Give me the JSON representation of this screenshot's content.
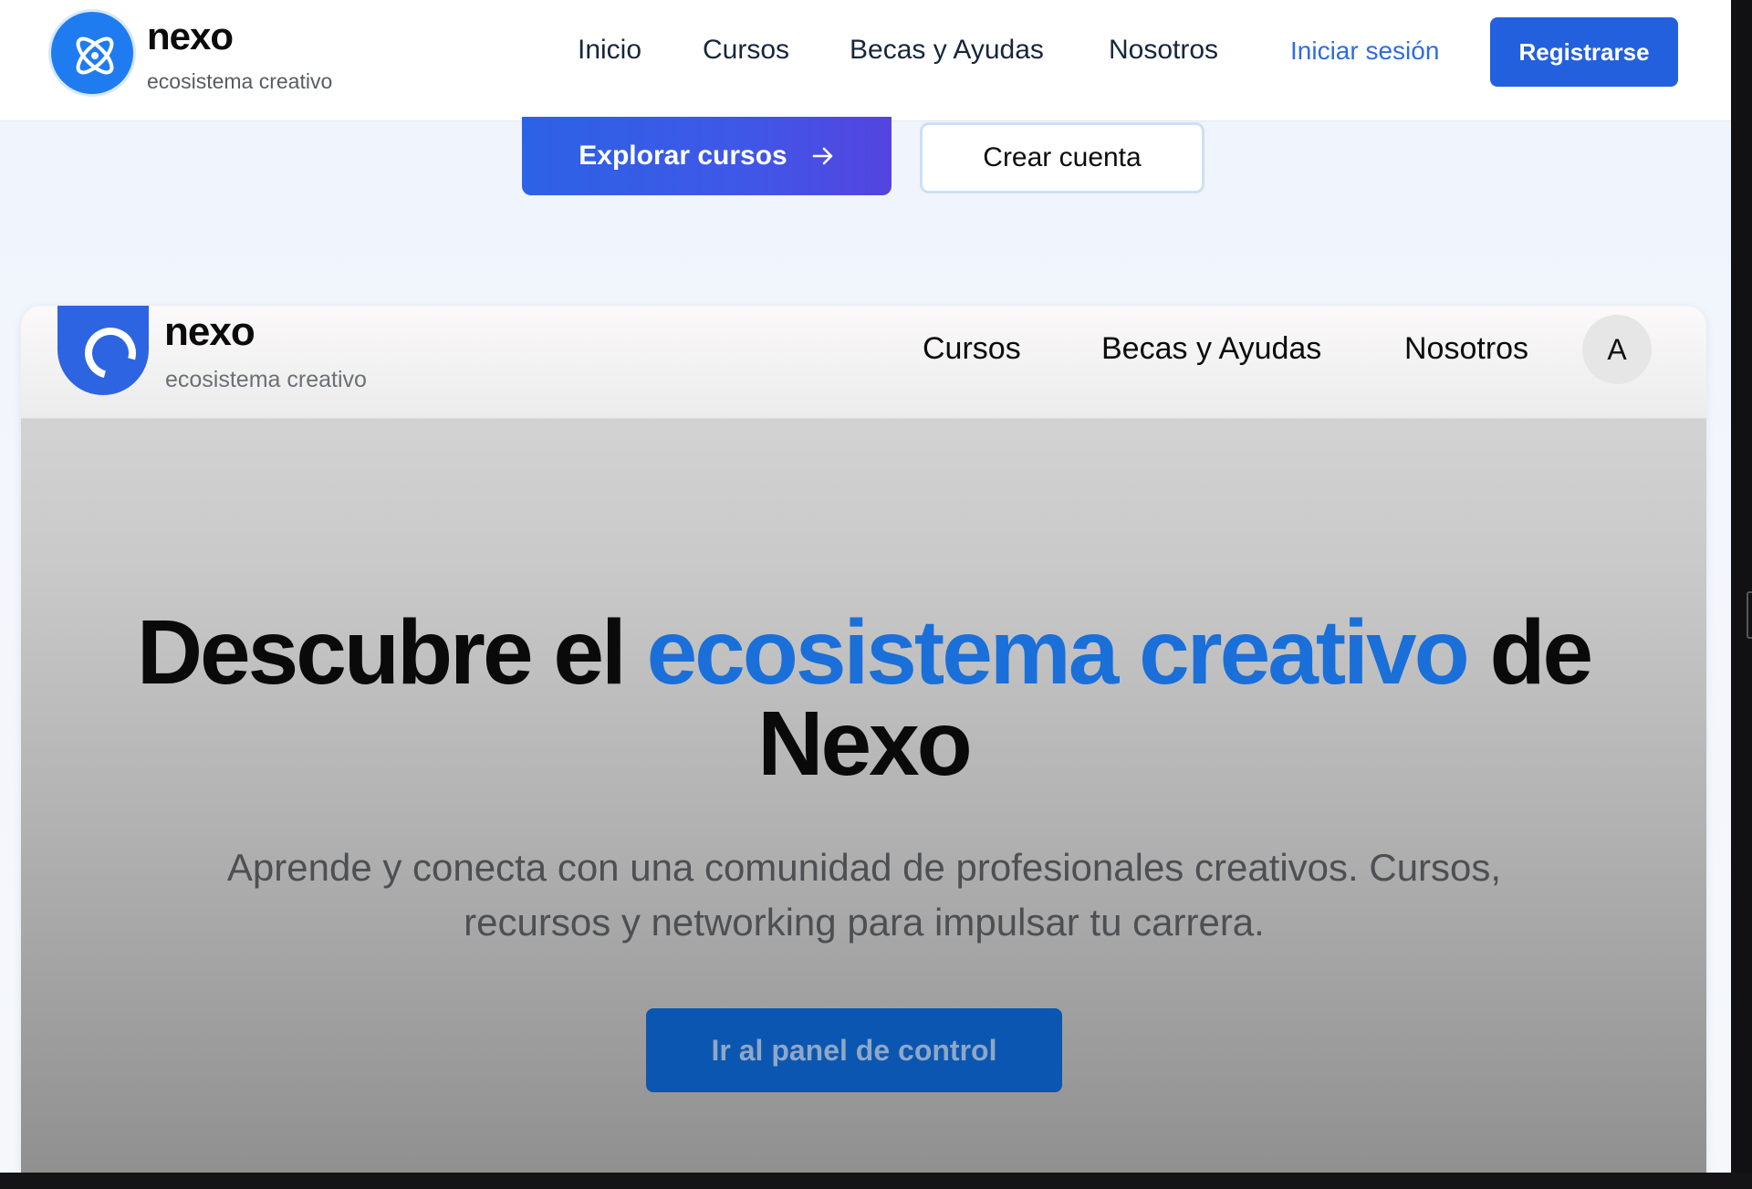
{
  "colors": {
    "brand_blue": "#1f7cf0",
    "accent_blue": "#2360dd",
    "link_blue": "#2f6ce0",
    "headline_accent": "#1a6fd9"
  },
  "topnav": {
    "logo_icon": "atom-icon",
    "brand_name": "nexo",
    "brand_tagline": "ecosistema creativo",
    "links": [
      "Inicio",
      "Cursos",
      "Becas y Ayudas",
      "Nosotros"
    ],
    "login": "Iniciar sesión",
    "register": "Registrarse"
  },
  "hero": {
    "explore_label": "Explorar cursos",
    "explore_icon": "arrow-right-icon",
    "create_label": "Crear cuenta"
  },
  "preview": {
    "logo_icon": "ring-icon",
    "brand_name": "nexo",
    "brand_tagline": "ecosistema creativo",
    "links": [
      "Cursos",
      "Becas y Ayudas",
      "Nosotros"
    ],
    "avatar_initial": "A",
    "headline": {
      "part1": "Descubre el ",
      "accent": "ecosistema creativo",
      "part2": " de",
      "line2": "Nexo"
    },
    "subtitle_line1": "Aprende y conecta con una comunidad de profesionales creativos. Cursos,",
    "subtitle_line2": "recursos y networking para impulsar tu carrera.",
    "cta_label": "Ir al panel de control"
  }
}
